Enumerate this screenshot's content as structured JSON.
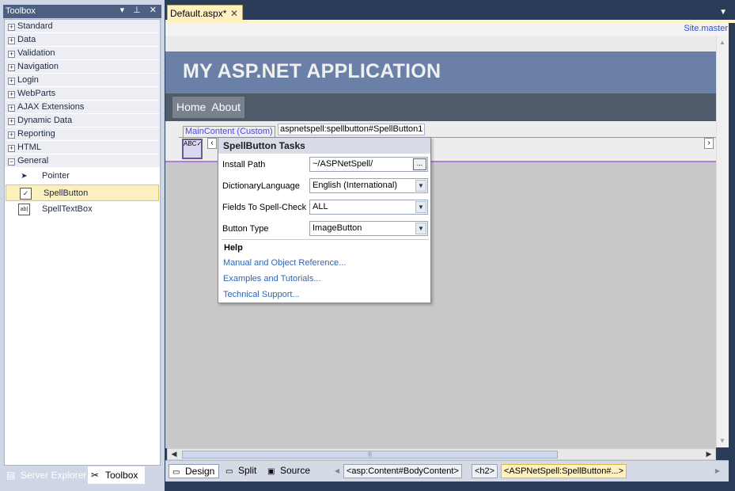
{
  "toolbox": {
    "title": "Toolbox",
    "title_icons": "▾ ⊥ ✕",
    "groups": [
      {
        "label": "Standard",
        "state": "+"
      },
      {
        "label": "Data",
        "state": "+"
      },
      {
        "label": "Validation",
        "state": "+"
      },
      {
        "label": "Navigation",
        "state": "+"
      },
      {
        "label": "Login",
        "state": "+"
      },
      {
        "label": "WebParts",
        "state": "+"
      },
      {
        "label": "AJAX Extensions",
        "state": "+"
      },
      {
        "label": "Dynamic Data",
        "state": "+"
      },
      {
        "label": "Reporting",
        "state": "+"
      },
      {
        "label": "HTML",
        "state": "+"
      },
      {
        "label": "General",
        "state": "−"
      }
    ],
    "items": [
      {
        "label": "Pointer",
        "icon": "pointer-icon",
        "glyph": "➤"
      },
      {
        "label": "SpellButton",
        "icon": "spellbutton-icon",
        "glyph": "✓",
        "selected": true
      },
      {
        "label": "SpellTextBox",
        "icon": "spelltextbox-icon",
        "glyph": "ab|"
      }
    ],
    "bottom_tabs": [
      {
        "label": "Server Explorer",
        "icon": "server-explorer-icon",
        "glyph": "▤"
      },
      {
        "label": "Toolbox",
        "icon": "toolbox-icon",
        "glyph": "✂"
      }
    ]
  },
  "document": {
    "tab_label": "Default.aspx*",
    "tab_close": "✕",
    "tab_menu": "▼",
    "master_link": "Site.master"
  },
  "page": {
    "app_title": "MY ASP.NET APPLICATION",
    "menu": [
      "Home",
      "About"
    ],
    "content_tag": "MainContent (Custom)",
    "control_tag": "aspnetspell:spellbutton#SpellButton1",
    "spell_glyph": "ABC✓"
  },
  "tasks": {
    "title": "SpellButton Tasks",
    "rows": [
      {
        "label": "Install Path",
        "value": "~/ASPNetSpell/",
        "kind": "browse"
      },
      {
        "label": "DictionaryLanguage",
        "value": "English (International)",
        "kind": "dropdown"
      },
      {
        "label": "Fields To Spell-Check",
        "value": "ALL",
        "kind": "dropdown"
      },
      {
        "label": "Button Type",
        "value": "ImageButton",
        "kind": "dropdown"
      }
    ],
    "browse_label": "...",
    "help_heading": "Help",
    "links": [
      "Manual and Object Reference...",
      "Examples and Tutorials...",
      "Technical Support..."
    ]
  },
  "viewbar": {
    "views": [
      {
        "label": "Design",
        "icon": "design-view-icon",
        "glyph": "▭",
        "active": true
      },
      {
        "label": "Split",
        "icon": "split-view-icon",
        "glyph": "▭"
      },
      {
        "label": "Source",
        "icon": "source-view-icon",
        "glyph": "▣"
      }
    ],
    "breadcrumbs": [
      "<asp:Content#BodyContent>",
      "<h2>",
      "<ASPNetSpell:SpellButton#...>"
    ]
  },
  "colors": {
    "header": "#6a80a6",
    "nav": "#505a68",
    "toolbox_title": "#4d6082",
    "selection": "#fcefc0",
    "link": "#2e66b8"
  }
}
